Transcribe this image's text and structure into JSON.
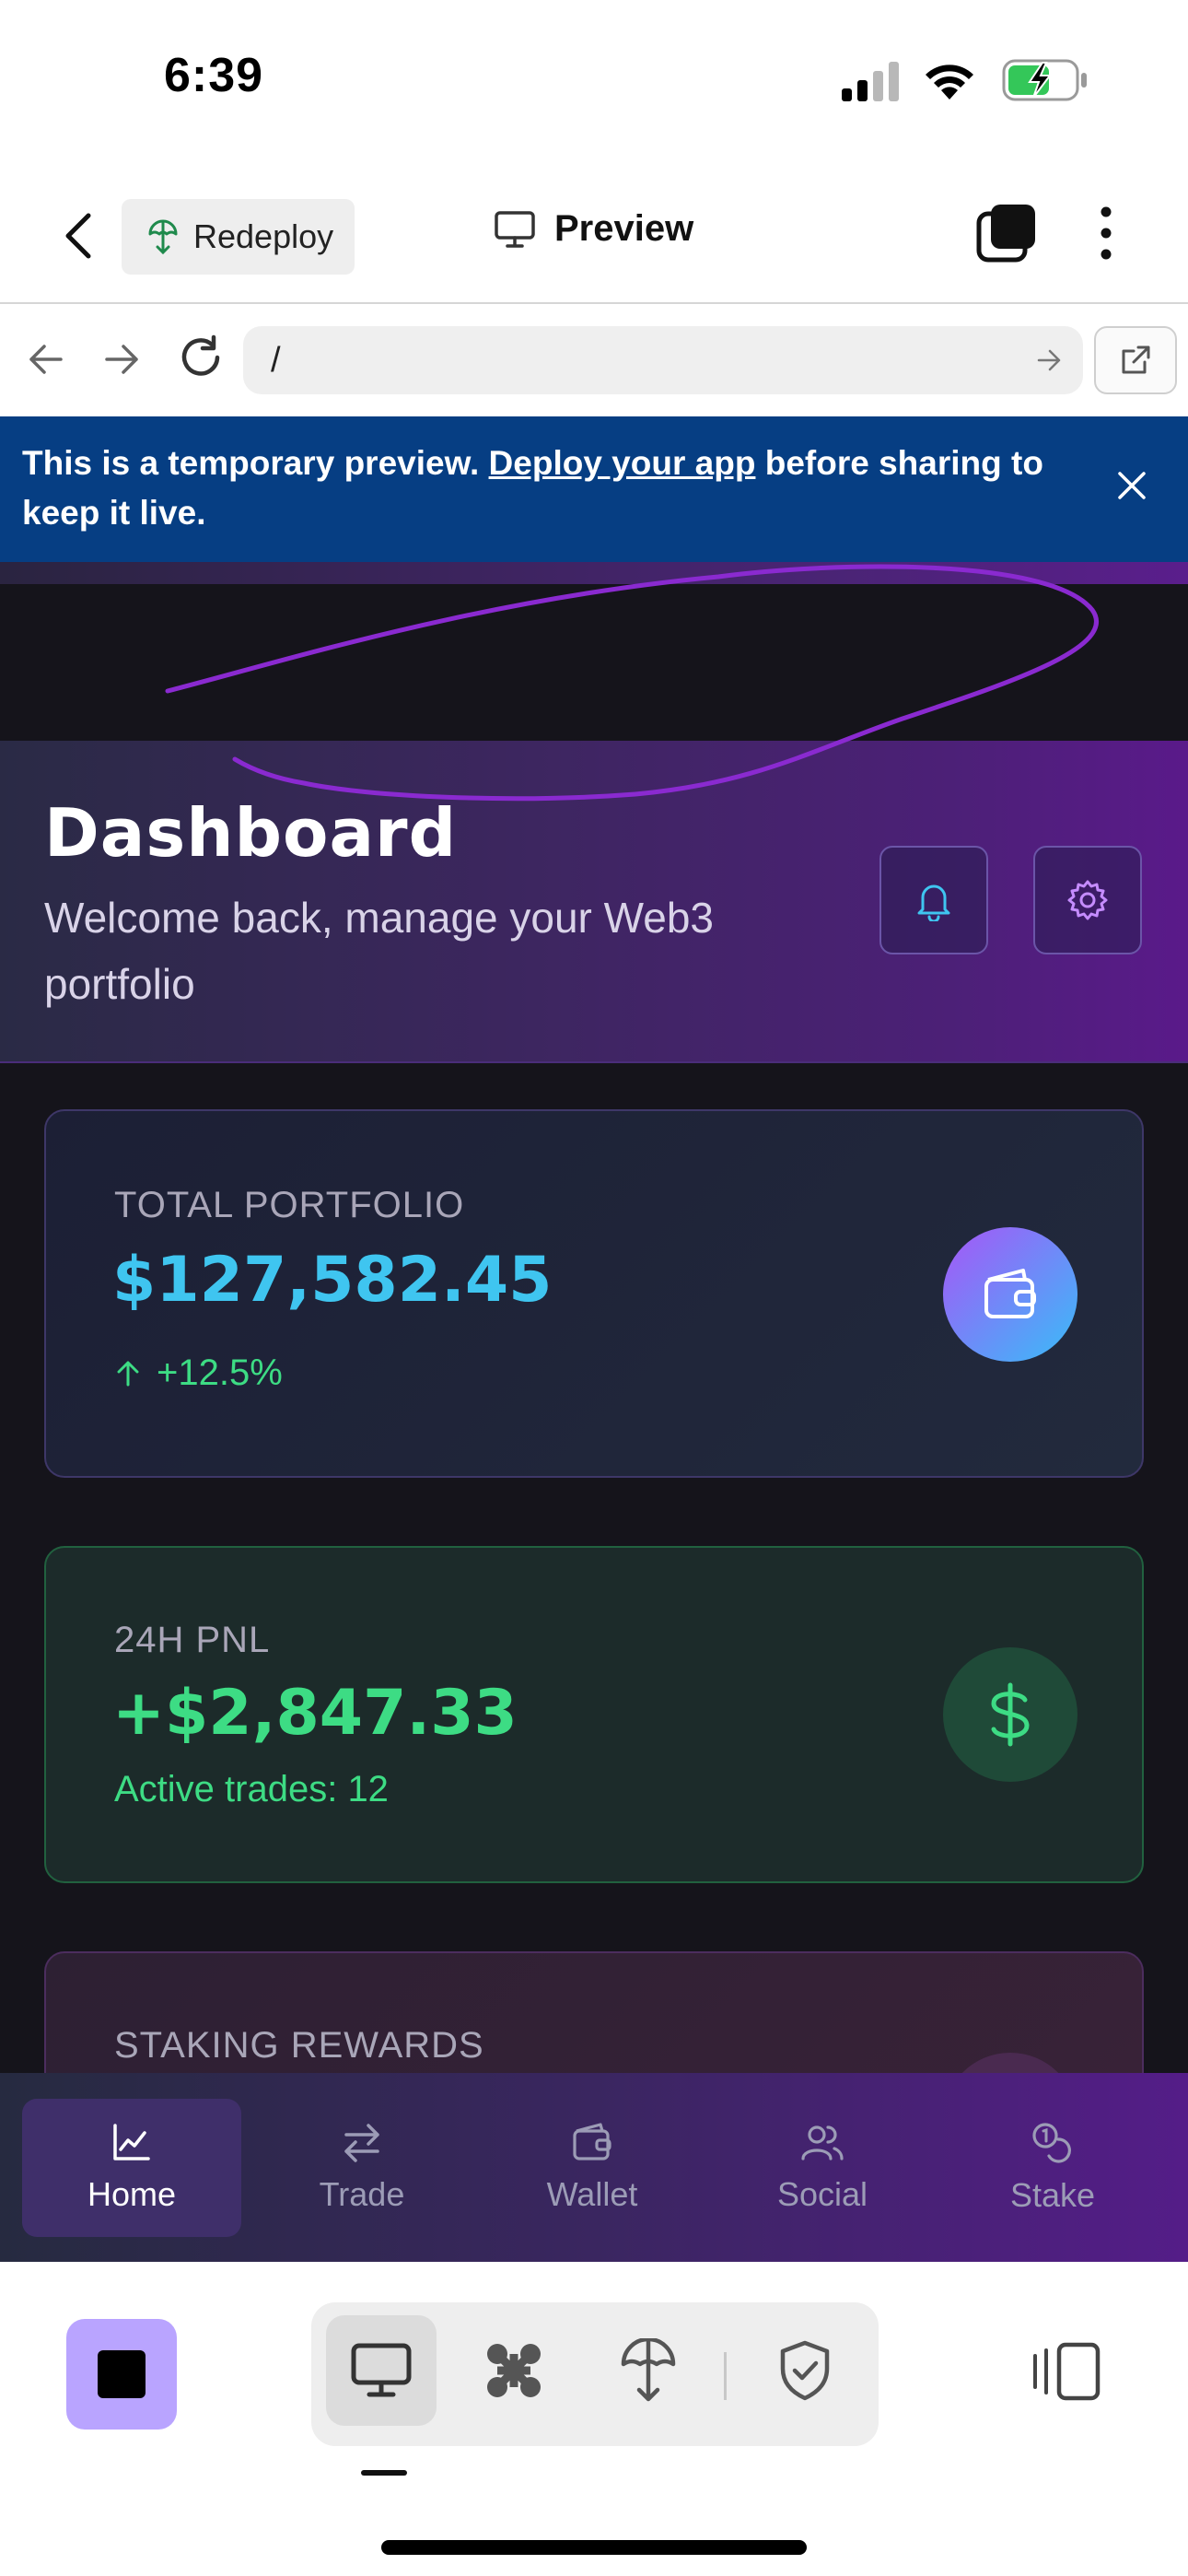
{
  "status_bar": {
    "time": "6:39"
  },
  "header": {
    "redeploy_label": "Redeploy",
    "preview_label": "Preview"
  },
  "url_bar": {
    "url": "/"
  },
  "banner": {
    "text_before": "This is a temporary preview. ",
    "link": "Deploy your app",
    "text_after": " before sharing to keep it live."
  },
  "hero": {
    "title": "Dashboard",
    "subtitle": "Welcome back, manage your Web3 portfolio"
  },
  "cards": {
    "portfolio": {
      "label": "TOTAL PORTFOLIO",
      "value": "$127,582.45",
      "change": "+12.5%"
    },
    "pnl": {
      "label": "24H PNL",
      "value": "+$2,847.33",
      "meta": "Active trades: 12"
    },
    "staking": {
      "label": "STAKING REWARDS"
    }
  },
  "bottom_nav": {
    "home": "Home",
    "trade": "Trade",
    "wallet": "Wallet",
    "social": "Social",
    "stake": "Stake"
  },
  "colors": {
    "accent_cyan": "#3fc5f0",
    "accent_green": "#3ddc84",
    "banner_bg": "#063e83",
    "stop_button": "#b9a4ff"
  }
}
